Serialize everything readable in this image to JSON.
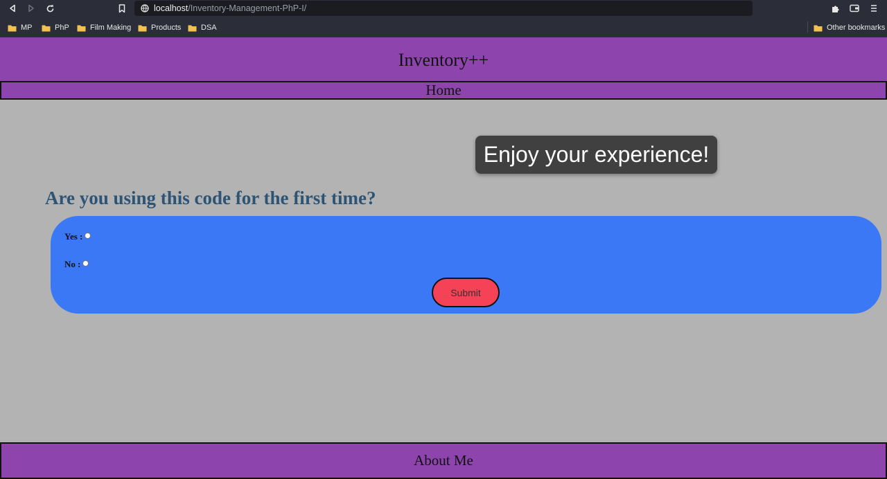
{
  "browser": {
    "url_host": "localhost",
    "url_path": "/Inventory-Management-PhP-I/",
    "bookmarks": [
      "MP",
      "PhP",
      "Film Making",
      "Products",
      "DSA"
    ],
    "other_bookmarks": "Other bookmarks",
    "icons": [
      "back-arrow-icon",
      "forward-arrow-icon",
      "reload-icon",
      "bookmark-icon",
      "site-info-icon",
      "folder-icon",
      "extensions-puzzle-icon",
      "wallet-icon",
      "browser-menu-icon"
    ]
  },
  "header": {
    "title": "Inventory++"
  },
  "nav": {
    "home": "Home"
  },
  "toast": {
    "message": "Enjoy your experience!"
  },
  "form": {
    "question": "Are you using this code for the first time?",
    "yes_label": "Yes :",
    "no_label": "No :",
    "submit_label": "Submit"
  },
  "footer": {
    "about": "About Me"
  },
  "colors": {
    "header_purple": "#8e44ad",
    "page_background": "#b3b3b3",
    "form_blue": "#3a78f6",
    "submit_red": "#f64257",
    "question_text": "#2e5475",
    "toast_background": "#404040"
  }
}
